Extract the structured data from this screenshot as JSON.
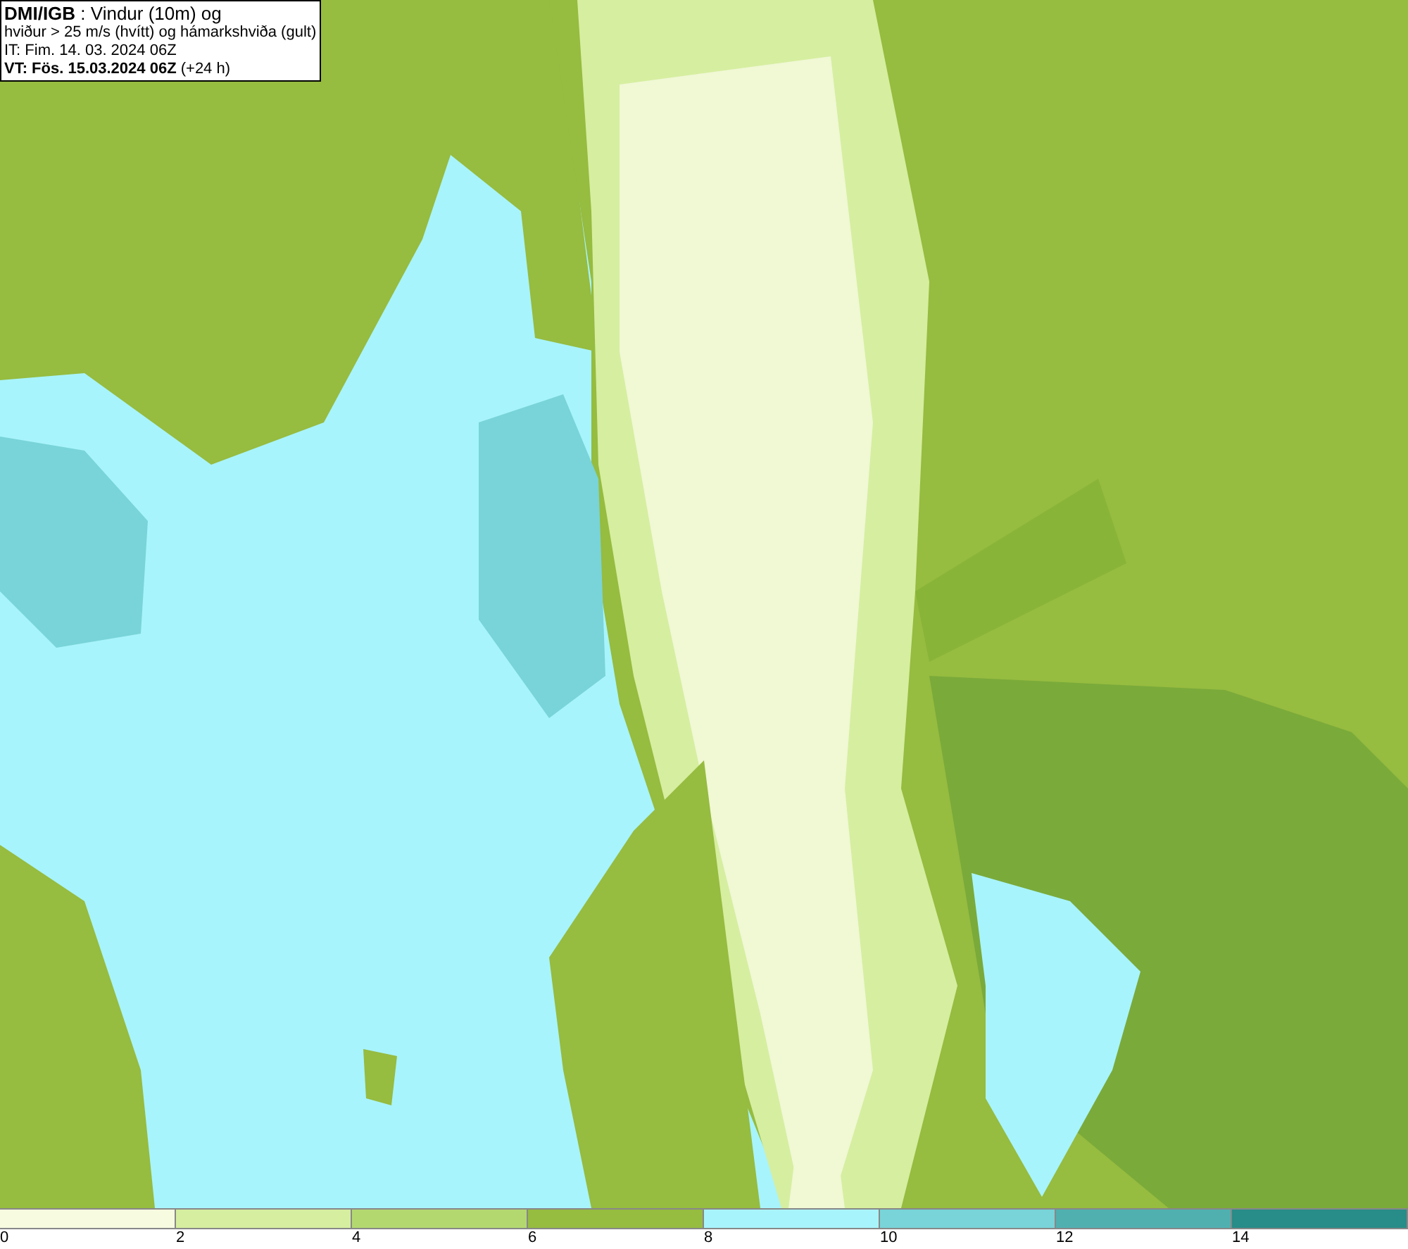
{
  "info_box": {
    "lines": [
      "**DMI/IGB** : Vindur (10m) og",
      "hviður > 25 m/s (hvítt) og hámarkshviða (gult)",
      "IT: Fim. 14. 03. 2024 06Z",
      "**VT: Fös. 15.03.2024 06Z** (+24 h)"
    ]
  },
  "legend": {
    "segments": [
      {
        "label": "0",
        "color": "#f7fbe0"
      },
      {
        "label": "2",
        "color": "#d6eea0"
      },
      {
        "label": "4",
        "color": "#b4d870"
      },
      {
        "label": "6",
        "color": "#96bc40"
      },
      {
        "label": "8",
        "color": "#a8f4fc"
      },
      {
        "label": "10",
        "color": "#78d4d8"
      },
      {
        "label": "12",
        "color": "#50b0b0"
      },
      {
        "label": "14",
        "color": "#288c88"
      }
    ]
  }
}
